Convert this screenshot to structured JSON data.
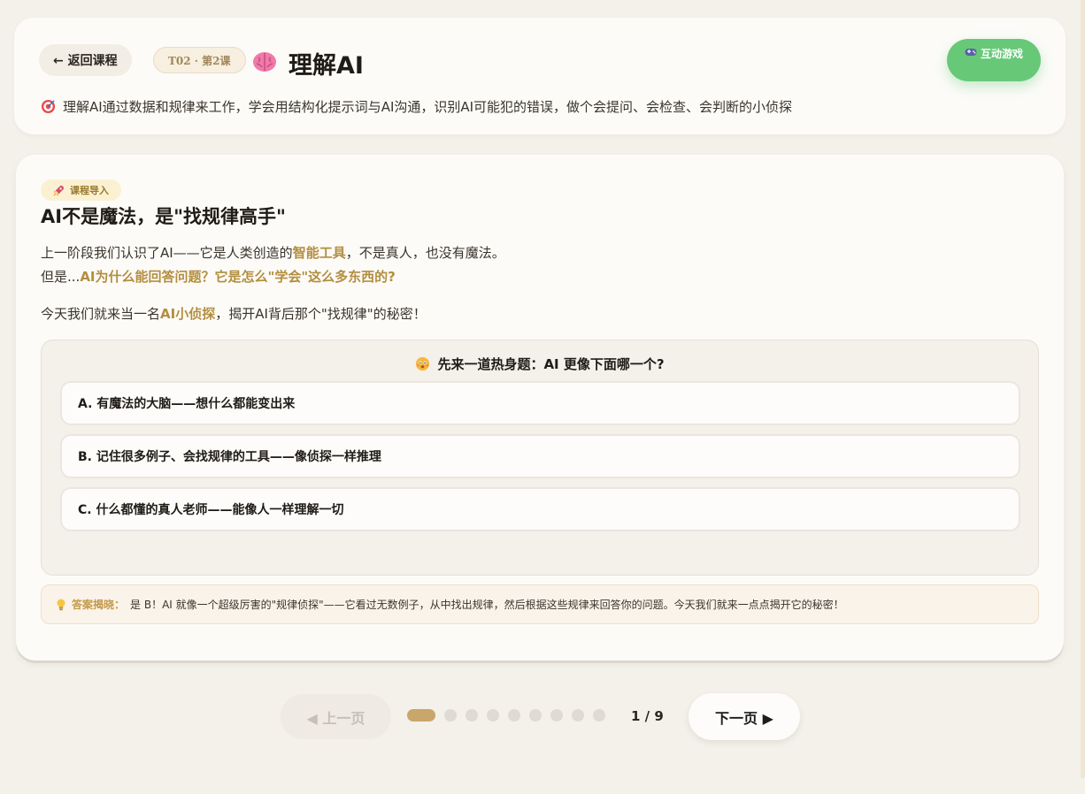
{
  "header": {
    "back_label": "← 返回课程",
    "lesson_badge": "T02 · 第2课",
    "title": "理解AI",
    "game_button": "互动游戏",
    "goal": "理解AI通过数据和规律来工作，学会用结构化提示词与AI沟通，识别AI可能犯的错误，做个会提问、会检查、会判断的小侦探"
  },
  "intro": {
    "tag": "课程导入",
    "title": "AI不是魔法，是\"找规律高手\"",
    "p1_a": "上一阶段我们认识了AI——它是人类创造的",
    "p1_hl": "智能工具",
    "p1_b": "，不是真人，也没有魔法。",
    "p2_a": "但是...",
    "p2_hl": "AI为什么能回答问题？它是怎么\"学会\"这么多东西的?",
    "p3_a": "今天我们就来当一名",
    "p3_hl": "AI小侦探",
    "p3_b": "，揭开AI背后那个\"找规律\"的秘密！"
  },
  "quiz": {
    "question": "先来一道热身题：AI 更像下面哪一个?",
    "options": [
      "A. 有魔法的大脑——想什么都能变出来",
      "B. 记住很多例子、会找规律的工具——像侦探一样推理",
      "C. 什么都懂的真人老师——能像人一样理解一切"
    ]
  },
  "answer": {
    "label": "答案揭晓：",
    "text": "是 B！AI 就像一个超级厉害的\"规律侦探\"——它看过无数例子，从中找出规律，然后根据这些规律来回答你的问题。今天我们就来一点点揭开它的秘密！"
  },
  "pagination": {
    "prev_label": "◀ 上一页",
    "next_label": "下一页 ▶",
    "indicator": "1 / 9",
    "current": 1,
    "total": 9
  },
  "icons": {
    "back": "arrow-left-icon",
    "brain": "brain-icon",
    "gamepad": "gamepad-icon",
    "target": "target-icon",
    "rocket": "rocket-icon",
    "thinking": "thinking-face-icon",
    "bulb": "lightbulb-icon"
  },
  "colors": {
    "accent": "#c9a66b",
    "highlight": "#b38e3f",
    "game_green": "#67c878"
  }
}
